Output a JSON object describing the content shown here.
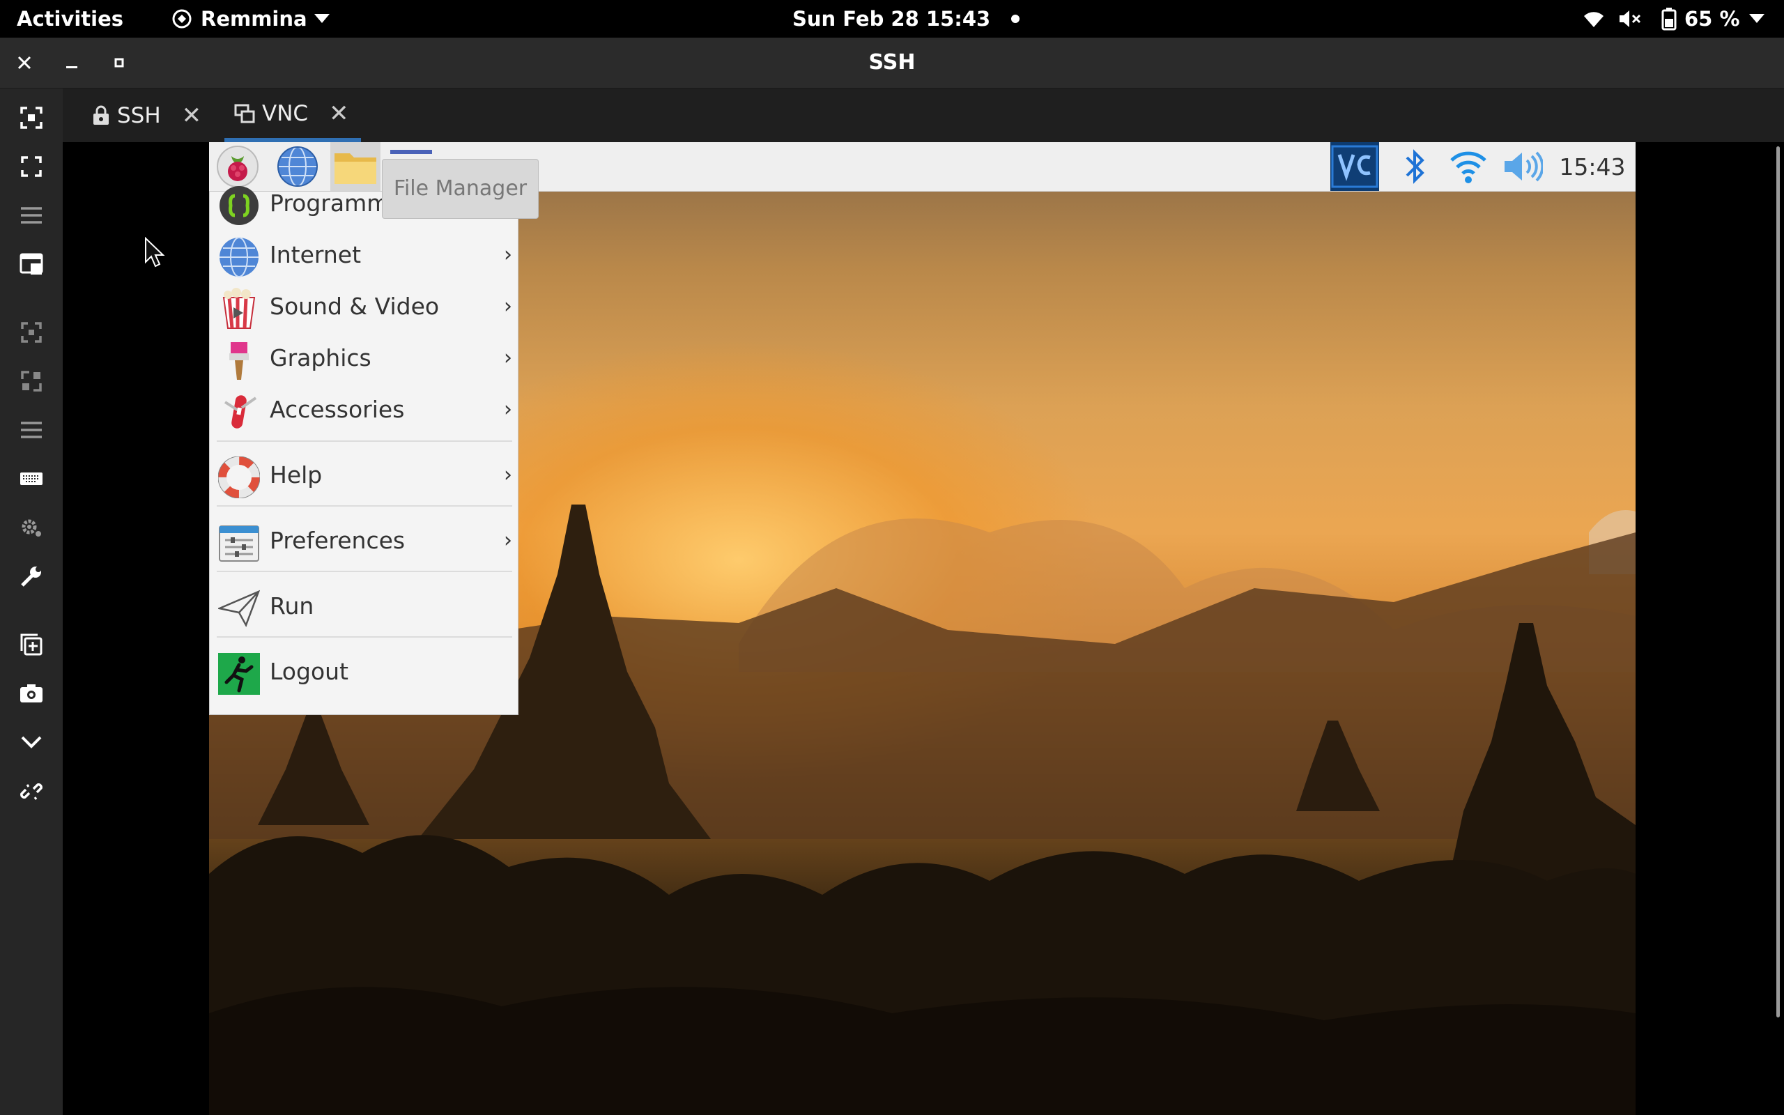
{
  "gnome_bar": {
    "activities": "Activities",
    "app_name": "Remmina",
    "datetime": "Sun Feb 28  15:43",
    "battery": "65 %"
  },
  "window": {
    "title": "SSH",
    "tabs": [
      {
        "label": "SSH",
        "icon": "lock-icon"
      },
      {
        "label": "VNC",
        "icon": "screens-icon",
        "active": true
      }
    ]
  },
  "sidebar_tools": [
    "fit-window-icon",
    "fullscreen-icon",
    "menu-icon",
    "scaled-view-icon",
    "dynamic-resolution-icon",
    "scale-icon",
    "menu-icon",
    "keyboard-icon",
    "settings-icon",
    "tools-icon",
    "duplicate-icon",
    "screenshot-icon",
    "chevron-down-icon",
    "disconnect-icon"
  ],
  "remote_panel": {
    "clock": "15:43"
  },
  "tooltip": "File Manager",
  "start_menu": {
    "items": [
      {
        "label": "Programming",
        "arrow": "›"
      },
      {
        "label": "Internet",
        "arrow": "›"
      },
      {
        "label": "Sound & Video",
        "arrow": "›"
      },
      {
        "label": "Graphics",
        "arrow": "›"
      },
      {
        "label": "Accessories",
        "arrow": "›"
      },
      {
        "label": "Help",
        "arrow": "›"
      },
      {
        "label": "Preferences",
        "arrow": "›"
      },
      {
        "label": "Run"
      },
      {
        "label": "Logout"
      }
    ]
  },
  "colors": {
    "accent": "#2f6fb3",
    "panel_bg": "#efefef",
    "menu_bg": "#f4f4f4"
  }
}
